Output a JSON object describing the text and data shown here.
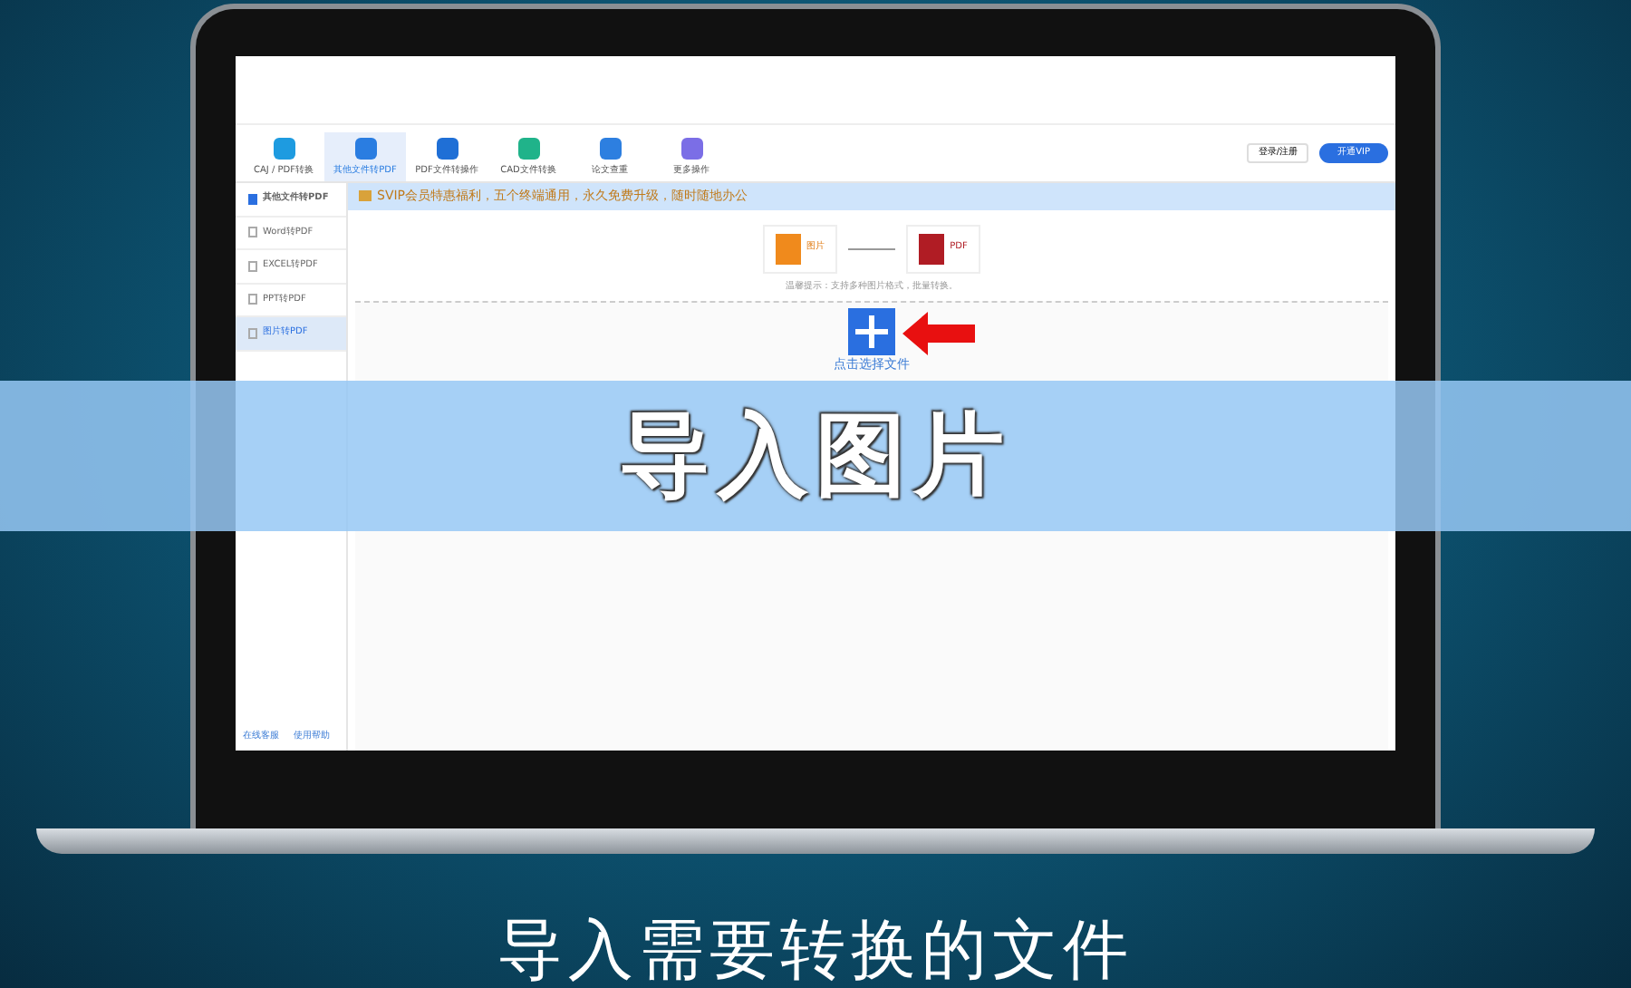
{
  "toolbar": {
    "tabs": [
      {
        "label": "CAJ / PDF转换",
        "selected": false,
        "color": "#1e9be0"
      },
      {
        "label": "其他文件转PDF",
        "selected": true,
        "color": "#2a7de1"
      },
      {
        "label": "PDF文件转操作",
        "selected": false,
        "color": "#1f6fd6"
      },
      {
        "label": "CAD文件转换",
        "selected": false,
        "color": "#20b38a"
      },
      {
        "label": "论文查重",
        "selected": false,
        "color": "#2d7fe0"
      },
      {
        "label": "更多操作",
        "selected": false,
        "color": "#7b6ee6"
      }
    ],
    "login": "登录/注册",
    "vip_button": "开通VIP"
  },
  "sidebar": {
    "header": "其他文件转PDF",
    "items": [
      {
        "label": "Word转PDF",
        "selected": false
      },
      {
        "label": "EXCEL转PDF",
        "selected": false
      },
      {
        "label": "PPT转PDF",
        "selected": false
      },
      {
        "label": "图片转PDF",
        "selected": true
      }
    ],
    "footer": [
      "在线客服",
      "使用帮助"
    ]
  },
  "banner": "SVIP会员特惠福利，五个终端通用，永久免费升级，随时随地办公",
  "conversion": {
    "from": "图片",
    "to": "PDF",
    "hint": "温馨提示：支持多种图片格式，批量转换。",
    "upload_label": "点击选择文件"
  },
  "overlay_title": "导入图片",
  "caption": "导入需要转换的文件"
}
